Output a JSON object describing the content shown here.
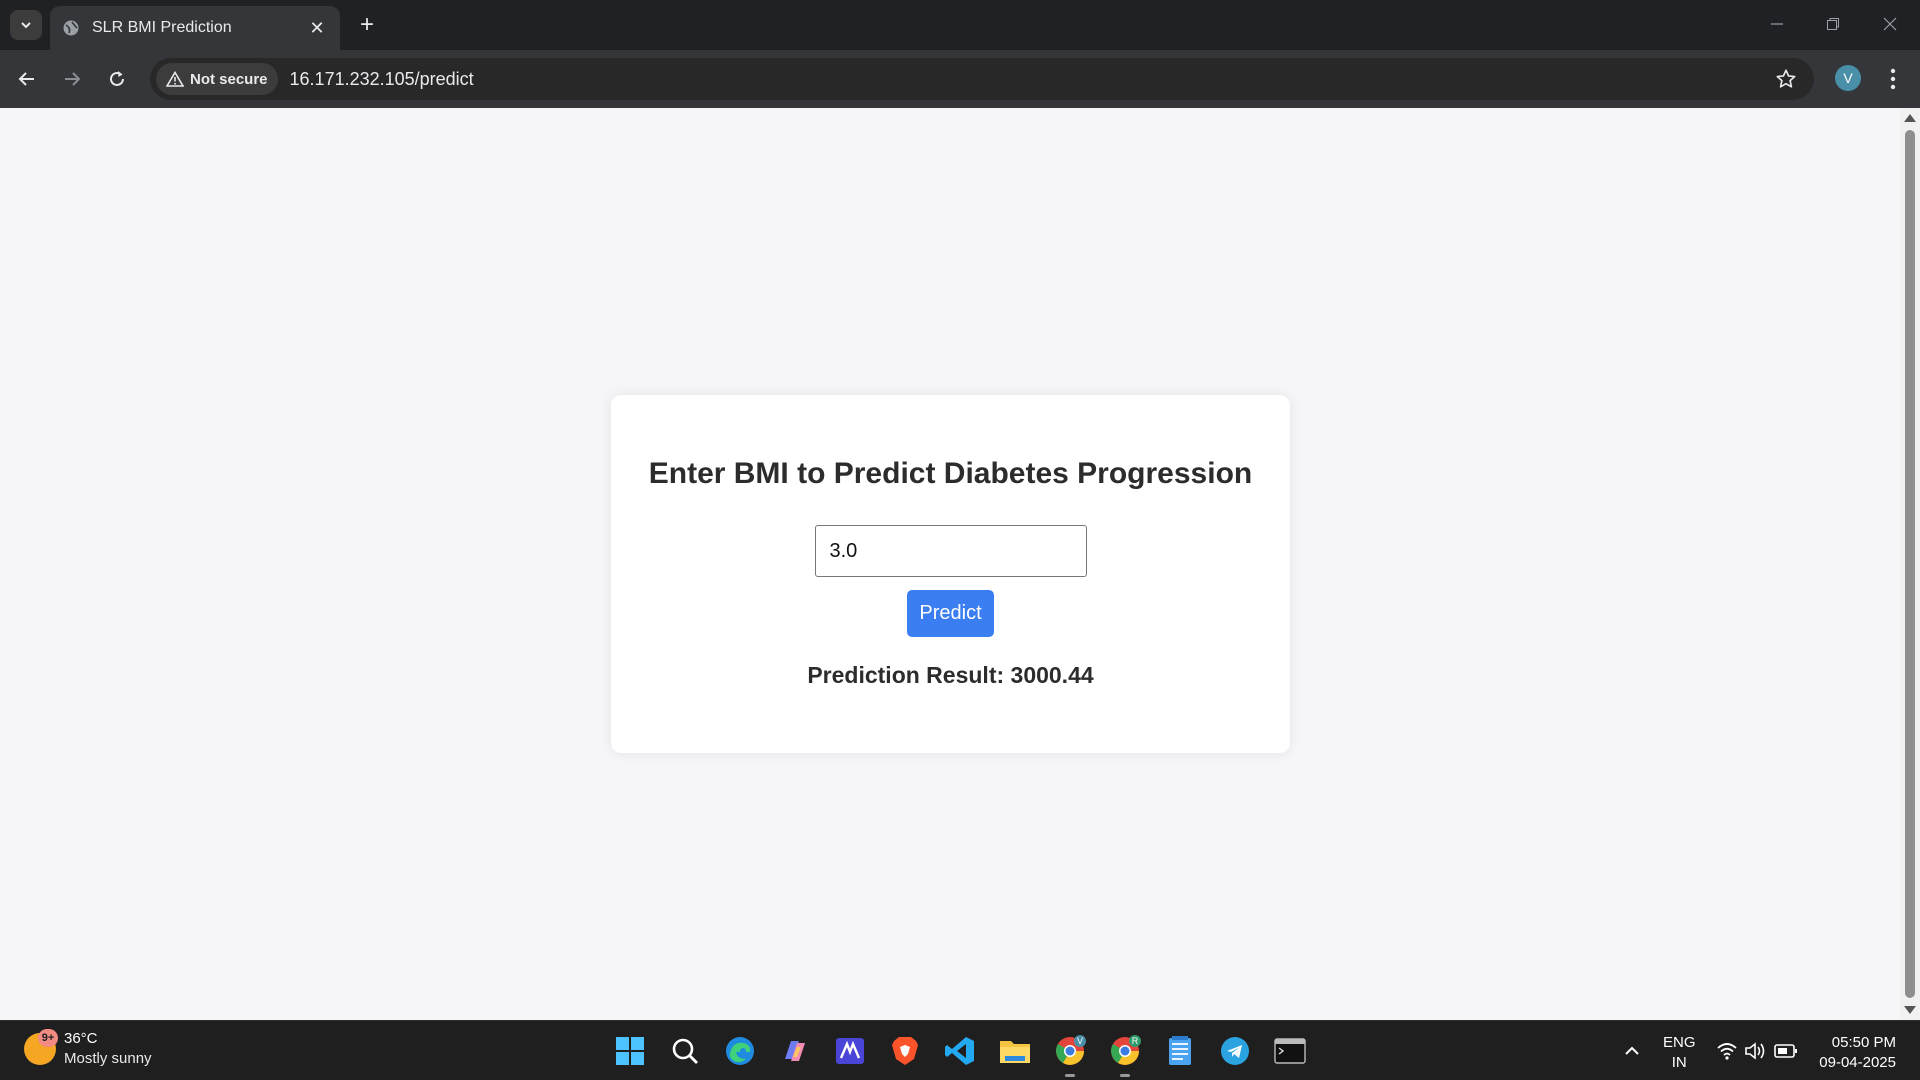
{
  "browser": {
    "tab": {
      "title": "SLR BMI Prediction"
    },
    "address": {
      "security_label": "Not secure",
      "url": "16.171.232.105/predict"
    },
    "profile_initial": "V"
  },
  "page": {
    "heading": "Enter BMI to Predict Diabetes Progression",
    "bmi_value": "3.0",
    "predict_label": "Predict",
    "result_text": "Prediction Result: 3000.44"
  },
  "taskbar": {
    "weather": {
      "badge": "9+",
      "temp": "36°C",
      "condition": "Mostly sunny"
    },
    "lang": {
      "line1": "ENG",
      "line2": "IN"
    },
    "clock": {
      "time": "05:50 PM",
      "date": "09-04-2025"
    },
    "chrome_badges": [
      "V",
      "R"
    ]
  },
  "colors": {
    "accent": "#3a7ef2",
    "page_bg": "#f6f5f8",
    "card_bg": "#ffffff"
  }
}
